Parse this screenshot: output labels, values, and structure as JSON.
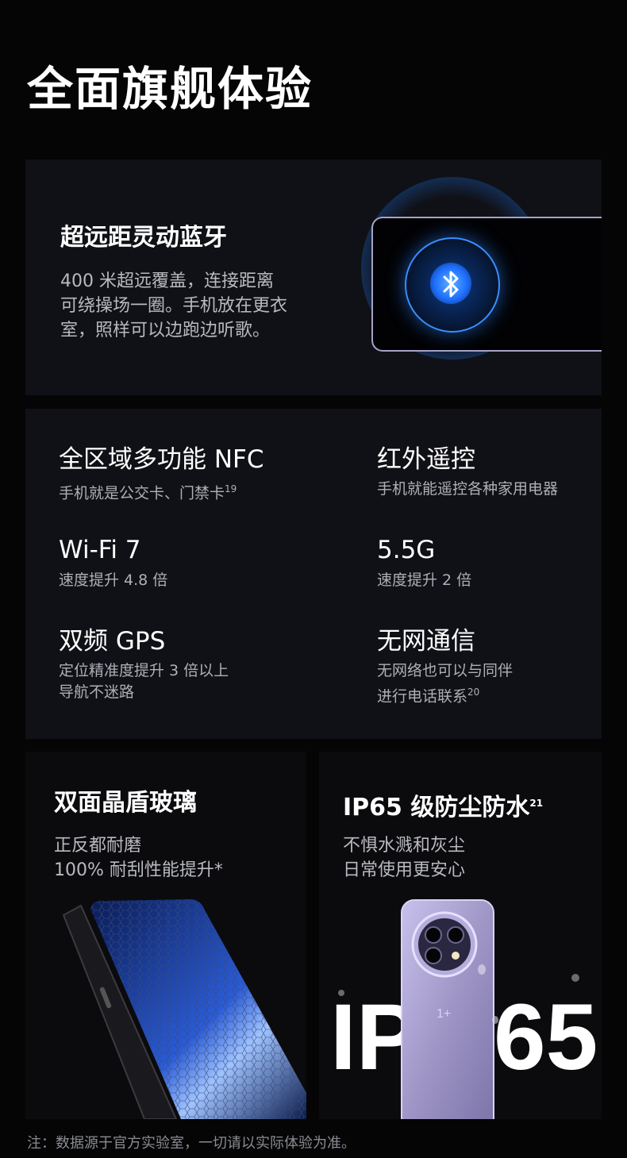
{
  "page": {
    "title": "全面旗舰体验",
    "footnote": "注：数据源于官方实验室，一切请以实际体验为准。"
  },
  "bluetooth": {
    "title": "超远距灵动蓝牙",
    "desc": "400 米超远覆盖，连接距离\n可绕操场一圈。手机放在更衣\n室，照样可以边跑边听歌。",
    "icon": "bluetooth-icon",
    "accent": "#1e7bff"
  },
  "features": [
    {
      "title": "全区域多功能 NFC",
      "sub": "手机就是公交卡、门禁卡",
      "sup": "19"
    },
    {
      "title": "红外遥控",
      "sub": "手机就能遥控各种家用电器",
      "sup": ""
    },
    {
      "title": "Wi-Fi 7",
      "sub": "速度提升 4.8 倍",
      "sup": ""
    },
    {
      "title": "5.5G",
      "sub": "速度提升 2 倍",
      "sup": ""
    },
    {
      "title": "双频 GPS",
      "sub": "定位精准度提升 3 倍以上\n导航不迷路",
      "sup": ""
    },
    {
      "title": "无网通信",
      "sub": "无网络也可以与同伴\n进行电话联系",
      "sup": "20"
    }
  ],
  "glass": {
    "title": "双面晶盾玻璃",
    "desc": "正反都耐磨\n100% 耐刮性能提升*"
  },
  "ip": {
    "title": "IP65 级防尘防水",
    "title_sup": "21",
    "desc": "不惧水溅和灰尘\n日常使用更安心",
    "big_left": "IP",
    "big_right": "65",
    "phone_color": "#a79fc9"
  }
}
